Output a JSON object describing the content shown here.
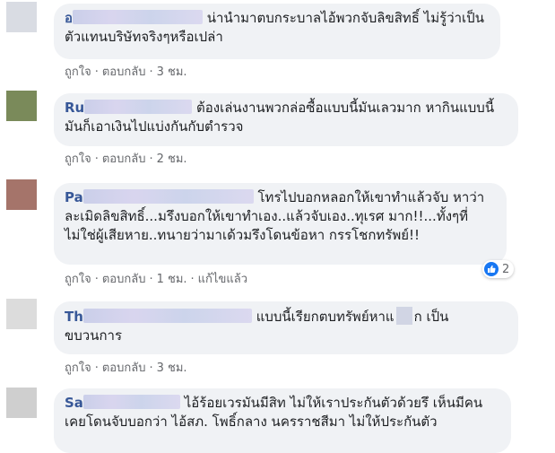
{
  "comments": [
    {
      "author_visible": "อ",
      "text": "น่านำมาตบกระบาลไอ้พวกจับลิขสิทธิ์ ไม่รู้ว่าเป็นตัวแทนบริษัทจริงๆหรือเปล่า",
      "actions": {
        "like": "ถูกใจ",
        "reply": "ตอบกลับ",
        "time": "3 ชม."
      },
      "avatar_color": "#d9dce3"
    },
    {
      "author_visible": "Ru",
      "text": "ต้องเล่นงานพวกล่อซื้อแบบนี้มันเลวมาก หากินแบบนี้มันก็เอาเงินไปแบ่งกันกับตำรวจ",
      "actions": {
        "like": "ถูกใจ",
        "reply": "ตอบกลับ",
        "time": "2 ชม."
      },
      "avatar_color": "#7a8a5a"
    },
    {
      "author_visible": "Pa",
      "text": "โทรไปบอกหลอกให้เขาทำแล้วจับ หาว่าละเมิดลิขสิทธิ์...มรึงบอกให้เขาทำเอง..แล้วจับเอง..ทุเรศ มาก!!...ทั้งๆที่ไม่ใช่ผู้เสียหาย..ทนายว่ามาเด้วมรึงโดนข้อหา กรรโชกทรัพย์!!",
      "actions": {
        "like": "ถูกใจ",
        "reply": "ตอบกลับ",
        "time": "1 ชม.",
        "edited": "แก้ไขแล้ว"
      },
      "reaction_count": "2",
      "avatar_color": "#a5746a"
    },
    {
      "author_visible": "Th",
      "text_before": "แบบนี้เรียกตบทรัพย์หาแ",
      "text_after": "ก เป็น ขบวนการ",
      "actions": {
        "like": "ถูกใจ",
        "reply": "ตอบกลับ",
        "time": "3 ชม."
      },
      "avatar_color": "#dcdcdc"
    },
    {
      "author_visible": "Sa",
      "text": "ไอ้ร้อยเวรมันมีสิท ไม่ให้เราประกันตัวด้วยรึ เห็นมีคนเคยโดนจับบอกว่า ไอ้สภ. โพธิ์กลาง นครราชสีมา ไม่ให้ประกันตัว",
      "avatar_color": "#cfcfcf"
    }
  ],
  "colors": {
    "author": "#385898",
    "bubble": "#f0f2f5",
    "meta": "#65676b",
    "like_blue": "#1877f2"
  },
  "icons": {
    "reaction": "like-icon"
  }
}
